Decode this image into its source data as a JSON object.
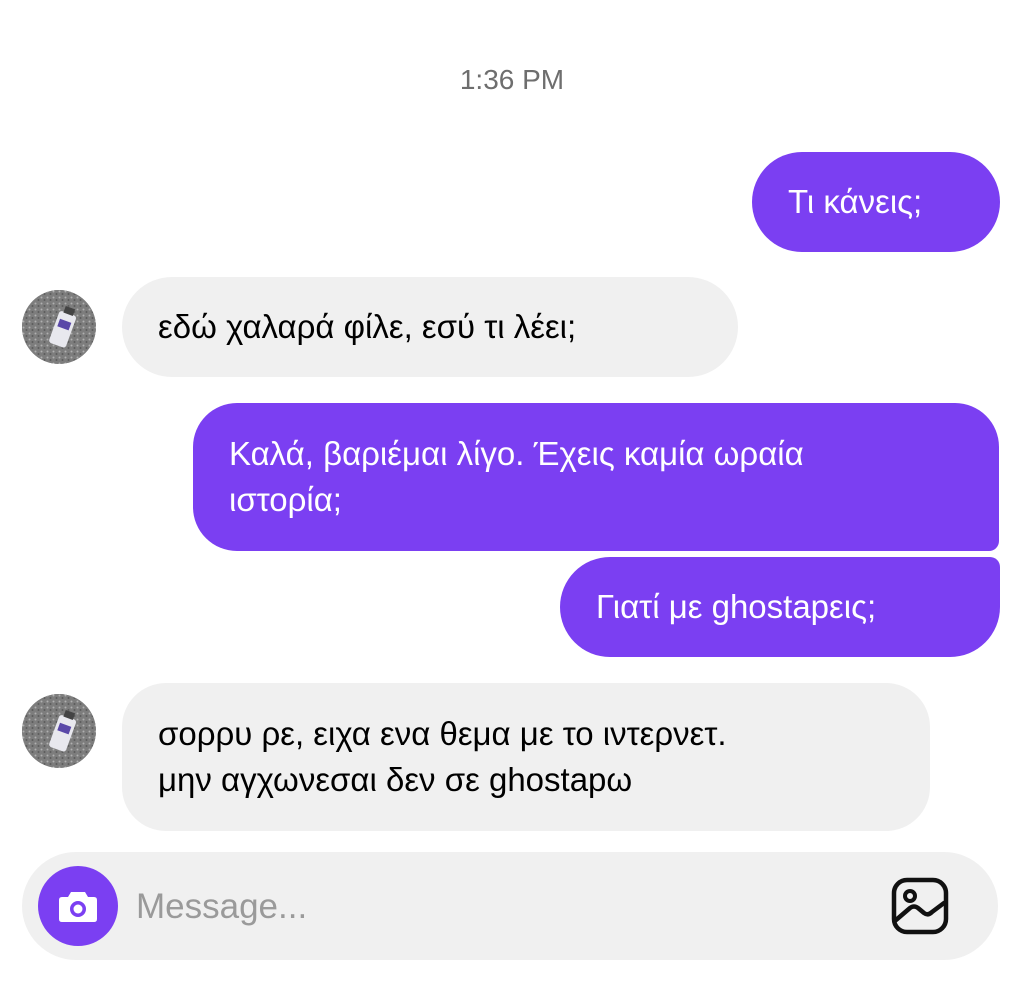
{
  "chat": {
    "timestamp": "1:36 PM",
    "messages": [
      {
        "direction": "out",
        "text": "Τι κάνεις;"
      },
      {
        "direction": "in",
        "text": "εδώ χαλαρά φίλε, εσύ τι λέει;"
      },
      {
        "direction": "out",
        "lines": [
          "Καλά, βαριέμαι λίγο. Έχεις καμία ωραία",
          "ιστορία;"
        ]
      },
      {
        "direction": "out",
        "text": "Γιατί με ghostapεις;"
      },
      {
        "direction": "in",
        "lines": [
          "σορρυ ρε, ειχα ενα θεμα με το ιντερνετ.",
          "μην αγχωνεσαι δεν σε ghostapω"
        ]
      }
    ]
  },
  "composer": {
    "placeholder": "Message...",
    "value": "",
    "camera_icon": "camera-icon",
    "gallery_icon": "image-gallery-icon"
  },
  "colors": {
    "accent": "#7b3ff2",
    "incoming_bubble": "#f0f0f0",
    "timestamp": "#6e6e6e",
    "placeholder": "#9a9a9a"
  }
}
